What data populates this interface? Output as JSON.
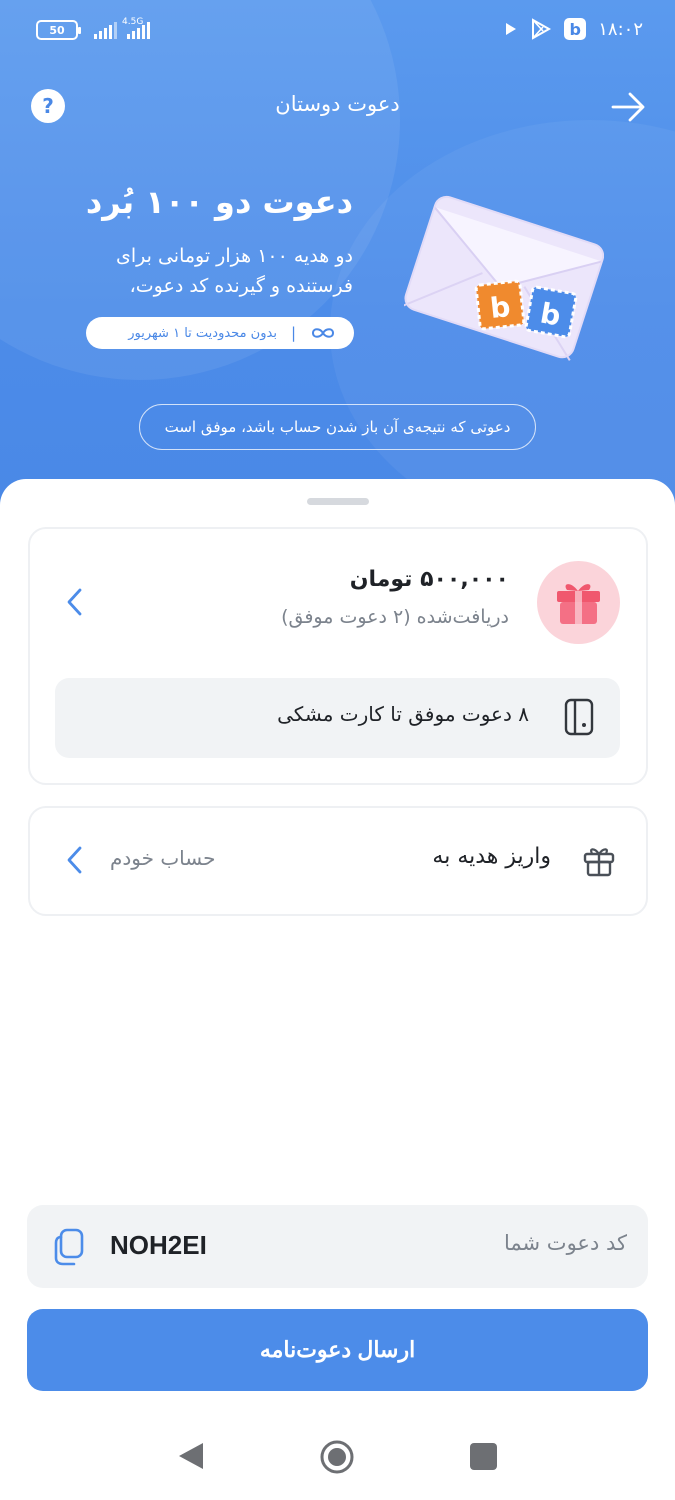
{
  "status_bar": {
    "battery": "50",
    "network": "4.5G",
    "time": "۱۸:۰۲"
  },
  "header": {
    "title": "دعوت دوستان",
    "help_label": "?"
  },
  "promo": {
    "title": "دعوت دو ۱۰۰ بُرد",
    "line1": "دو هدیه ۱۰۰ هزار تومانی برای",
    "line2": "فرستنده و گیرنده کد دعوت،",
    "pill_text": "بدون محدودیت تا ۱ شهریور",
    "pill_sep": "|",
    "info": "دعوتی که نتیجه‌ی آن باز شدن حساب باشد، موفق است"
  },
  "reward": {
    "amount": "۵۰۰,۰۰۰ تومان",
    "received": "دریافت‌شده (۲ دعوت موفق)",
    "progress": "۸ دعوت موفق تا کارت مشکی"
  },
  "deposit": {
    "label": "واریز هدیه به",
    "value": "حساب خودم"
  },
  "invite_code": {
    "label": "کد دعوت شما",
    "code": "NOH2EI"
  },
  "send_button": "ارسال دعوت‌نامه",
  "colors": {
    "primary": "#4c8ce9",
    "gift_pink": "#f0586e",
    "stamp_orange": "#f08a2e"
  }
}
